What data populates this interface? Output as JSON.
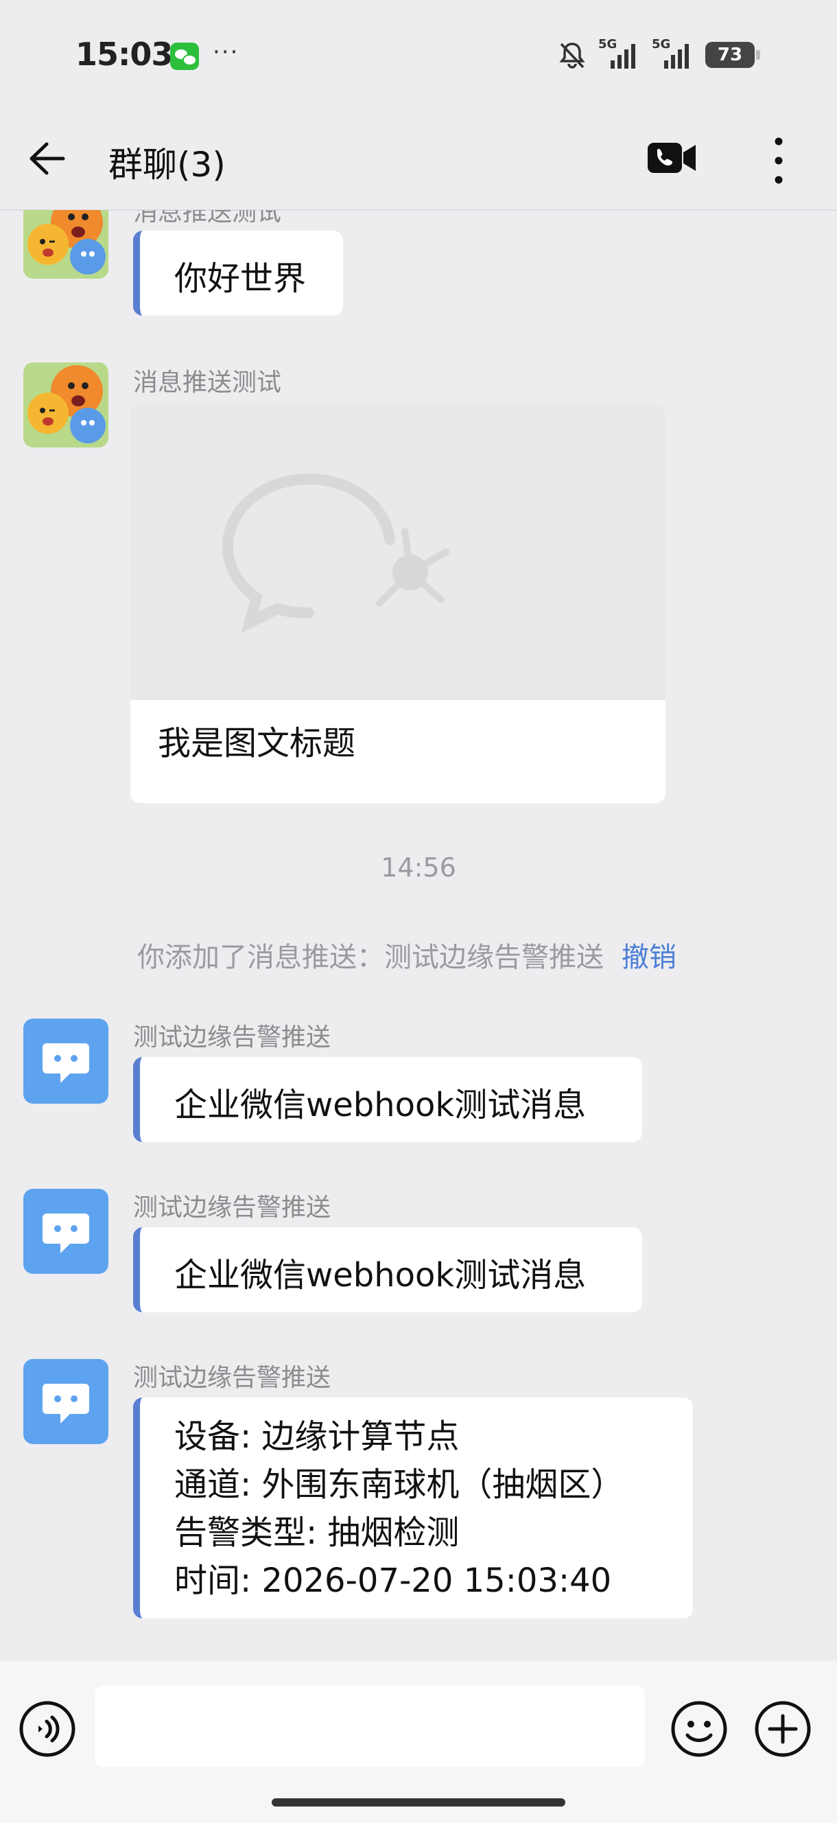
{
  "status_bar": {
    "time": "15:03",
    "more": "···",
    "signal1_label": "5G",
    "signal2_label": "5G",
    "battery": "73"
  },
  "header": {
    "title": "群聊(3)"
  },
  "messages": {
    "m1": {
      "sender": "消息推送测试",
      "text": "你好世界"
    },
    "m2": {
      "sender": "消息推送测试",
      "card_title": "我是图文标题"
    },
    "time_separator": "14:56",
    "system": {
      "text": "你添加了消息推送：测试边缘告警推送",
      "action": "撤销"
    },
    "m3": {
      "sender": "测试边缘告警推送",
      "text": "企业微信webhook测试消息"
    },
    "m4": {
      "sender": "测试边缘告警推送",
      "text": "企业微信webhook测试消息"
    },
    "m5": {
      "sender": "测试边缘告警推送",
      "lines": [
        "设备: 边缘计算节点",
        "通道: 外围东南球机（抽烟区）",
        "告警类型: 抽烟检测",
        "时间: 2026-07-20 15:03:40"
      ]
    }
  },
  "input": {
    "value": "",
    "placeholder": ""
  },
  "colors": {
    "background": "#ededf0",
    "bubble_accent": "#5a7fd0",
    "bot_avatar": "#5ea3ef",
    "link": "#4d7fd6",
    "wechat_green": "#2bbf3c"
  },
  "icons": [
    "back-arrow-icon",
    "video-call-icon",
    "more-vertical-icon",
    "voice-icon",
    "emoji-icon",
    "plus-icon",
    "wechat-icon",
    "notification-off-icon",
    "signal-icon",
    "battery-icon",
    "chat-bubble-icon"
  ]
}
